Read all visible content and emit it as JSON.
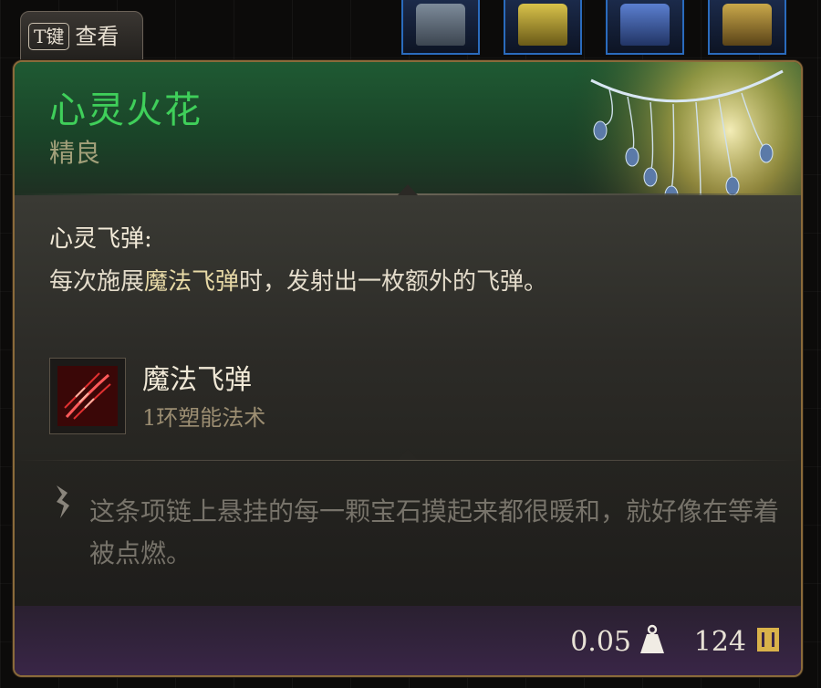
{
  "hotkey": {
    "key": "T键",
    "action": "查看"
  },
  "item": {
    "name": "心灵火花",
    "rarity": "精良",
    "name_color": "#3fcf5a"
  },
  "feature": {
    "name": "心灵飞弹:",
    "desc_pre": "每次施展",
    "desc_highlight": "魔法飞弹",
    "desc_post": "时，发射出一枚额外的飞弹。"
  },
  "spell": {
    "name": "魔法飞弹",
    "level": "1环塑能法术",
    "icon": "magic-missile-icon"
  },
  "flavor": "这条项链上悬挂的每一颗宝石摸起来都很暖和，就好像在等着被点燃。",
  "footer": {
    "weight": "0.05",
    "weight_icon": "weight-icon",
    "price": "124",
    "price_icon": "gold-coin-icon"
  }
}
